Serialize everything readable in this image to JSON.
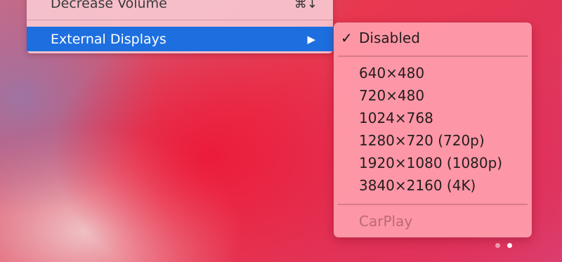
{
  "colors": {
    "highlight": "#1d6fe0",
    "menu_background": "#f8c8d0",
    "submenu_background": "#ff9eac"
  },
  "parent_menu": {
    "items": [
      {
        "label": "Decrease Volume",
        "shortcut": "⌘↓"
      },
      {
        "label": "External Displays",
        "submenu_arrow": "▶",
        "highlighted": true
      }
    ]
  },
  "submenu": {
    "selected": "Disabled",
    "checkmark": "✓",
    "items": [
      {
        "label": "Disabled",
        "checked": true
      },
      {
        "label": "640×480"
      },
      {
        "label": "720×480"
      },
      {
        "label": "1024×768"
      },
      {
        "label": "1280×720 (720p)"
      },
      {
        "label": "1920×1080 (1080p)"
      },
      {
        "label": "3840×2160 (4K)"
      },
      {
        "label": "CarPlay",
        "enabled": false
      }
    ]
  },
  "page_indicator": {
    "count": 2,
    "active_index": 1
  }
}
